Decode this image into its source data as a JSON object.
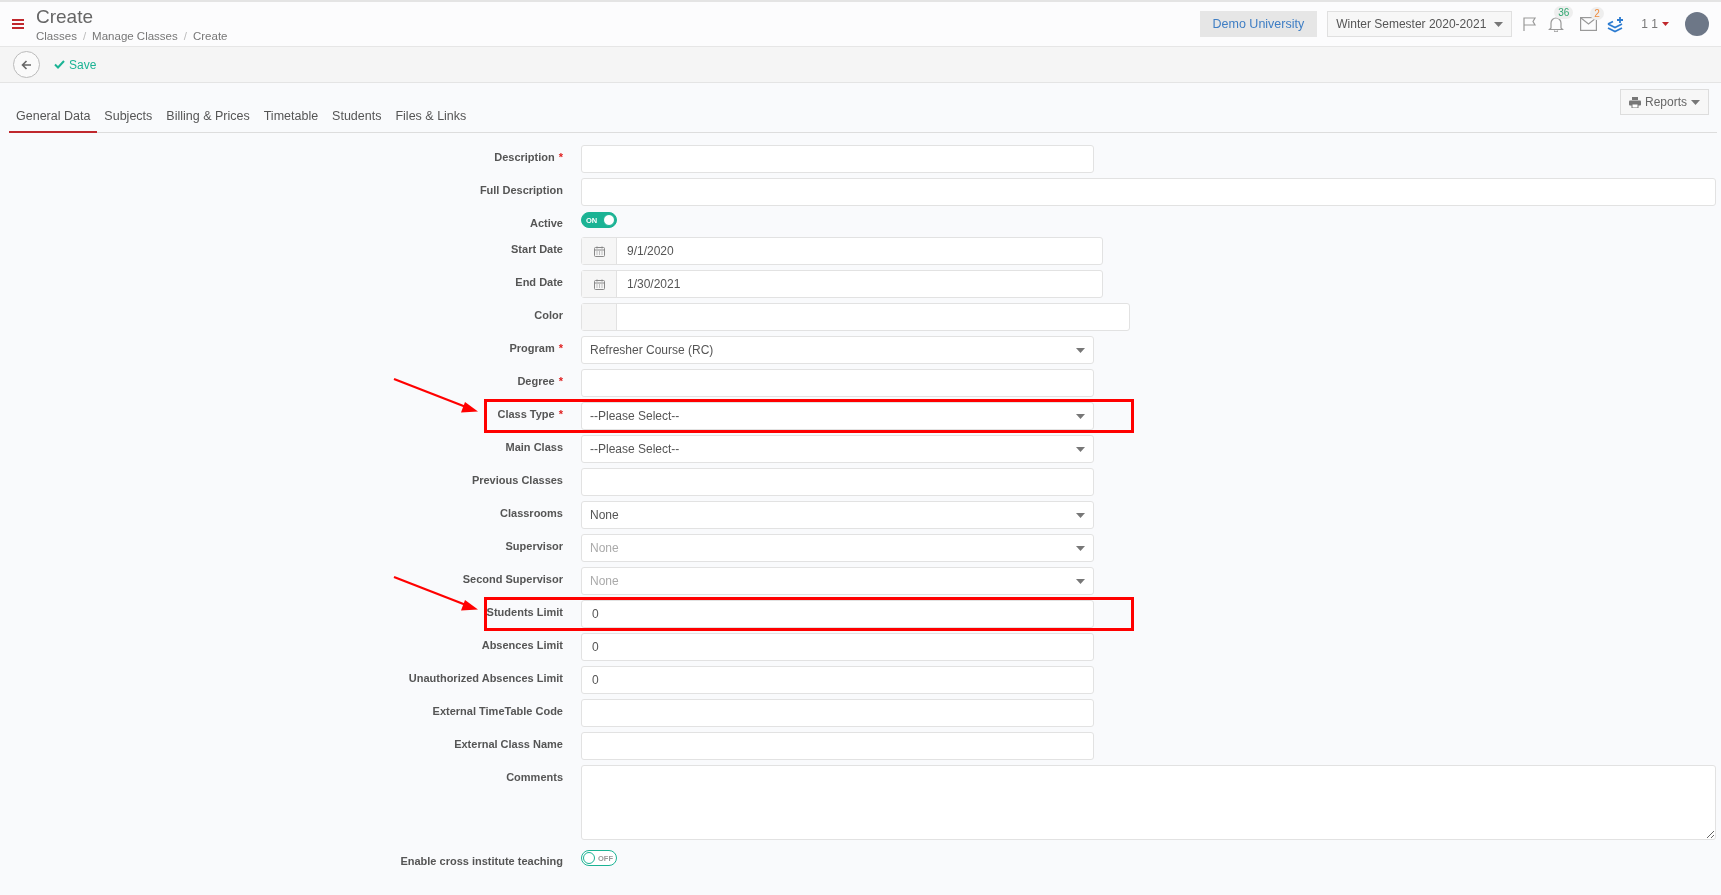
{
  "header": {
    "title": "Create",
    "breadcrumbs": [
      "Classes",
      "Manage Classes",
      "Create"
    ],
    "separator": "/",
    "institution": "Demo University",
    "semester": "Winter Semester 2020-2021",
    "notifications": "36",
    "messages": "2",
    "user": "1 1"
  },
  "toolbar": {
    "save": "Save"
  },
  "tabs": [
    {
      "label": "General Data",
      "selected": true
    },
    {
      "label": "Subjects",
      "selected": false
    },
    {
      "label": "Billing & Prices",
      "selected": false
    },
    {
      "label": "Timetable",
      "selected": false
    },
    {
      "label": "Students",
      "selected": false
    },
    {
      "label": "Files & Links",
      "selected": false
    }
  ],
  "reports": "Reports",
  "fields": [
    {
      "kind": "text",
      "label": "Description",
      "marker": "*",
      "highlighted": false
    },
    {
      "kind": "wide",
      "label": "Full Description",
      "highlighted": false
    },
    {
      "kind": "toggle",
      "label": "Active",
      "on": true,
      "state_text": "ON",
      "highlighted": false
    },
    {
      "kind": "date",
      "label": "Start Date",
      "value": "9/1/2020",
      "highlighted": false
    },
    {
      "kind": "date",
      "label": "End Date",
      "value": "1/30/2021",
      "highlighted": false
    },
    {
      "kind": "color",
      "label": "Color",
      "highlighted": false
    },
    {
      "kind": "select",
      "label": "Program",
      "marker": "*",
      "value": "Refresher Course (RC)",
      "highlighted": false
    },
    {
      "kind": "text",
      "label": "Degree",
      "marker": "*",
      "highlighted": false
    },
    {
      "kind": "select",
      "label": "Class Type",
      "marker": "*",
      "value": "--Please Select--",
      "highlighted": true
    },
    {
      "kind": "select",
      "label": "Main Class",
      "value": "--Please Select--",
      "highlighted": false
    },
    {
      "kind": "text",
      "label": "Previous Classes",
      "highlighted": false
    },
    {
      "kind": "select",
      "label": "Classrooms",
      "value": "None",
      "highlighted": false
    },
    {
      "kind": "select",
      "label": "Supervisor",
      "placeholder": "None",
      "highlighted": false
    },
    {
      "kind": "select",
      "label": "Second Supervisor",
      "placeholder": "None",
      "highlighted": false
    },
    {
      "kind": "text",
      "label": "Students Limit",
      "value": "0",
      "highlighted": true
    },
    {
      "kind": "text",
      "label": "Absences Limit",
      "value": "0",
      "highlighted": false
    },
    {
      "kind": "text",
      "label": "Unauthorized Absences Limit",
      "value": "0",
      "highlighted": false
    },
    {
      "kind": "text",
      "label": "External TimeTable Code",
      "highlighted": false
    },
    {
      "kind": "text",
      "label": "External Class Name",
      "highlighted": false
    },
    {
      "kind": "textarea",
      "label": "Comments",
      "highlighted": false
    },
    {
      "kind": "toggle",
      "label": "Enable cross institute teaching",
      "on": false,
      "state_text": "OFF",
      "highlighted": false
    }
  ]
}
